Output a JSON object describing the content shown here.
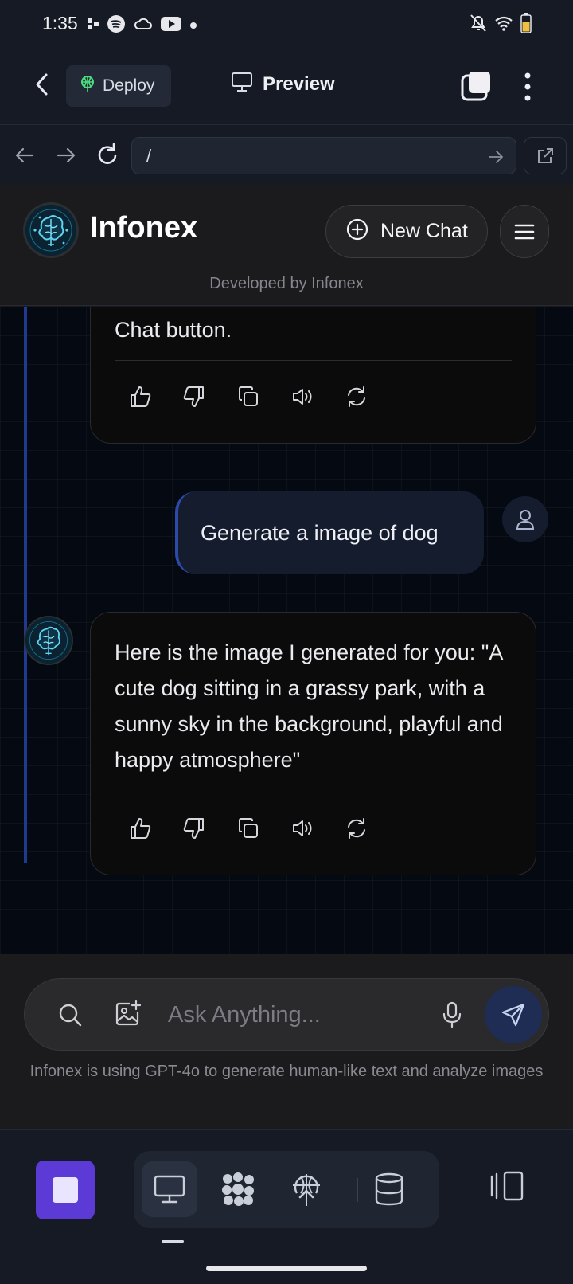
{
  "status_bar": {
    "time": "1:35"
  },
  "top_bar": {
    "deploy_label": "Deploy",
    "preview_label": "Preview"
  },
  "browser": {
    "url": "/"
  },
  "app_header": {
    "brand": "Infonex",
    "new_chat_label": "New Chat",
    "tagline": "Developed by Infonex"
  },
  "chat": {
    "messages": [
      {
        "role": "assistant",
        "text": "Chat button."
      },
      {
        "role": "user",
        "text": "Generate a image of dog"
      },
      {
        "role": "assistant",
        "text": "Here is the image I generated for you: \"A cute dog sitting in a grassy park, with a sunny sky in the background, playful and happy atmosphere\""
      }
    ]
  },
  "composer": {
    "placeholder": "Ask Anything...",
    "disclaimer": "Infonex is using GPT-4o to generate human-like text and analyze images"
  },
  "theme": {
    "accent": "#5b3ad6",
    "user_bubble": "#151c2e",
    "bot_bubble": "#0b0b0c",
    "rail": "#1f3a8f"
  }
}
